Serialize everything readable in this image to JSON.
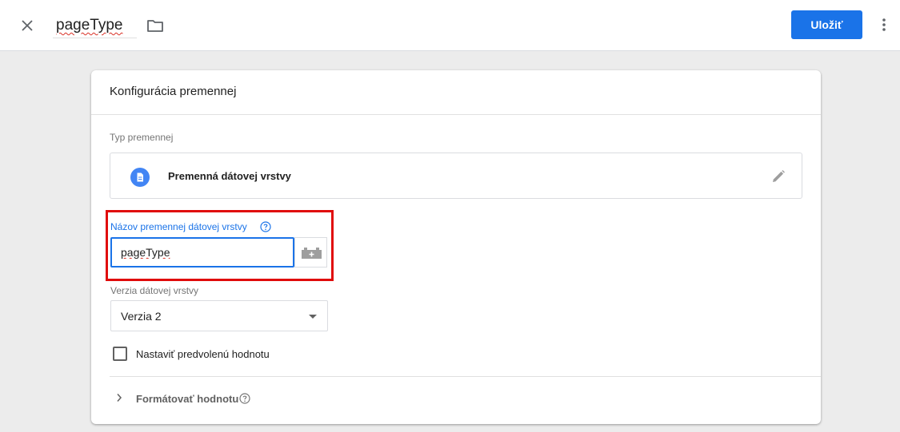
{
  "header": {
    "close_icon": "close-icon",
    "title": "pageType",
    "folder_icon": "folder-icon",
    "save_label": "Uložiť",
    "more_icon": "more-vert-icon"
  },
  "card": {
    "title": "Konfigurácia premennej",
    "type_section_label": "Typ premennej",
    "type_name": "Premenná dátovej vrstvy",
    "type_icon": "document-icon",
    "edit_icon": "pencil-icon",
    "name_field": {
      "label": "Názov premennej dátovej vrstvy",
      "value": "pageType",
      "help_icon": "help-icon",
      "variable_button_icon": "variable-picker-icon"
    },
    "version_field": {
      "label": "Verzia dátovej vrstvy",
      "value": "Verzia 2"
    },
    "default_value_checkbox": {
      "label": "Nastaviť predvolenú hodnotu",
      "checked": false
    },
    "format_value": {
      "label": "Formátovať hodnotu",
      "icon": "chevron-right-icon"
    }
  },
  "colors": {
    "accent": "#1a73e8",
    "highlight_box": "#e00b0b",
    "background": "#ececec"
  }
}
